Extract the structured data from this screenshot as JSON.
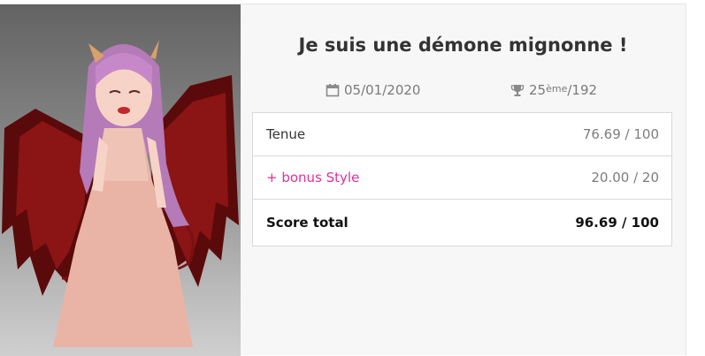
{
  "outfit": {
    "title": "Je suis une démone mignonne !",
    "date": "05/01/2020",
    "rank": {
      "position": "25",
      "suffix": "ème",
      "total": "/192"
    },
    "icons": {
      "date": "calendar-icon",
      "rank": "trophy-icon"
    }
  },
  "scores": {
    "outfit_label": "Tenue",
    "outfit_value": "76.69 / 100",
    "bonus_label": "+ bonus Style",
    "bonus_value": "20.00 / 20",
    "total_label": "Score total",
    "total_value": "96.69 / 100"
  },
  "colors": {
    "bonus": "#e0309b",
    "panel": "#f7f7f7",
    "text": "#333333"
  }
}
